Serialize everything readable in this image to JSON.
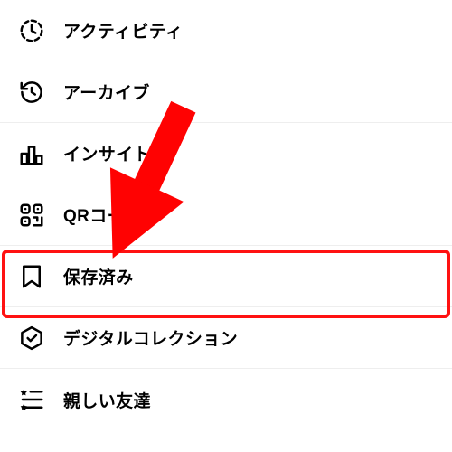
{
  "menu": {
    "items": [
      {
        "label": "アクティビティ"
      },
      {
        "label": "アーカイブ"
      },
      {
        "label": "インサイト"
      },
      {
        "label": "QRコード"
      },
      {
        "label": "保存済み"
      },
      {
        "label": "デジタルコレクション"
      },
      {
        "label": "親しい友達"
      }
    ]
  },
  "annotation": {
    "highlighted_index": 4
  }
}
